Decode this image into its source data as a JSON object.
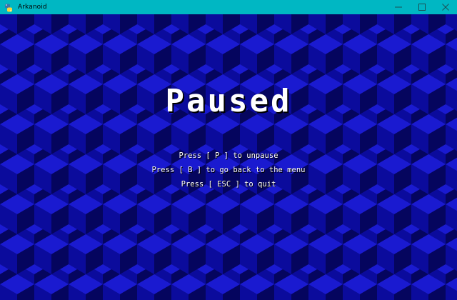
{
  "window": {
    "title": "Arkanoid",
    "app_icon": "python-icon",
    "controls": [
      "minimize-icon",
      "maximize-icon",
      "close-icon"
    ],
    "titlebar_color": "#00b7c3"
  },
  "game": {
    "heading": "Paused",
    "instructions": [
      "Press [ P ] to unpause",
      "Press [ B ] to go back to the menu",
      "Press [ ESC ] to quit"
    ],
    "background_colors": {
      "top": "#1a1ad0",
      "left": "#0b0b9c",
      "right": "#05055e"
    },
    "text_color": "#ffffff"
  }
}
